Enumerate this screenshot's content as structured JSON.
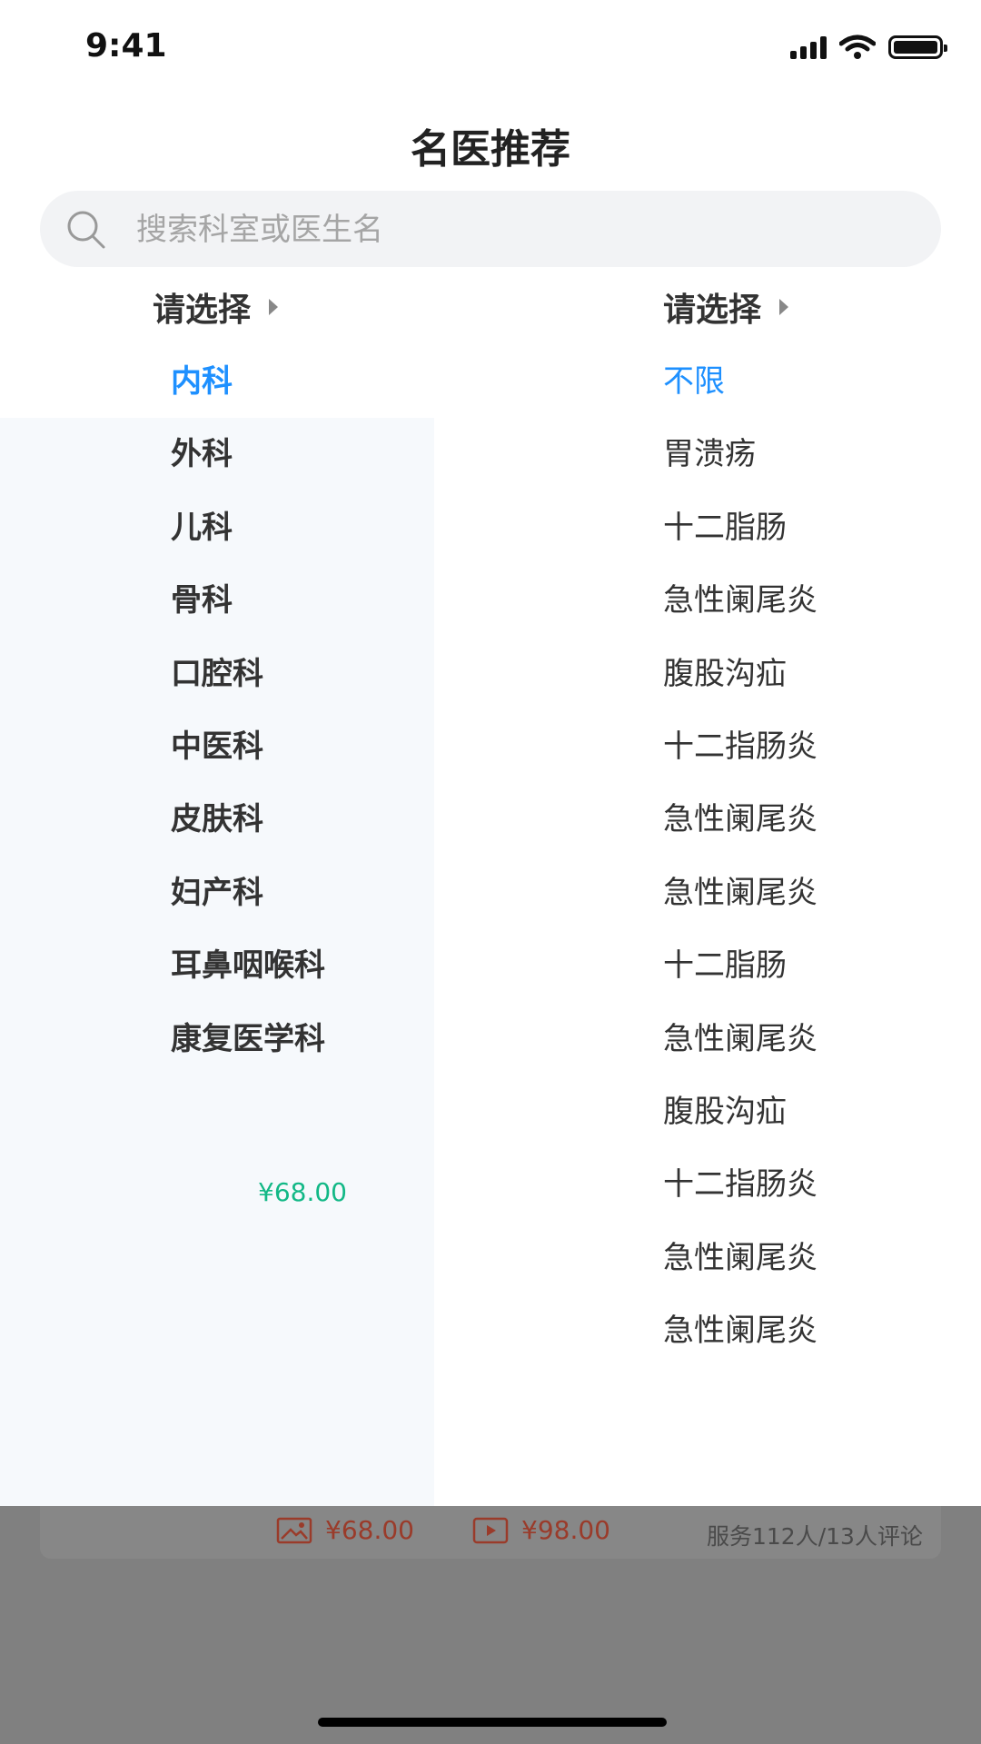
{
  "status_bar": {
    "time": "9:41"
  },
  "header": {
    "title": "名医推荐"
  },
  "search": {
    "placeholder": "搜索科室或医生名"
  },
  "filters": {
    "left_label": "请选择",
    "right_label": "请选择"
  },
  "departments": {
    "selected": "内科",
    "items": [
      "内科",
      "外科",
      "儿科",
      "骨科",
      "口腔科",
      "中医科",
      "皮肤科",
      "妇产科",
      "耳鼻咽喉科",
      "康复医学科"
    ]
  },
  "diseases": {
    "selected": "不限",
    "items": [
      "不限",
      "胃溃疡",
      "十二脂肠",
      "急性阑尾炎",
      "腹股沟疝",
      "十二指肠炎",
      "急性阑尾炎",
      "急性阑尾炎",
      "十二脂肠",
      "急性阑尾炎",
      "腹股沟疝",
      "十二指肠炎",
      "急性阑尾炎",
      "急性阑尾炎"
    ]
  },
  "left_panel_price": "¥68.00",
  "background_card": {
    "image_price": "¥68.00",
    "video_price": "¥98.00",
    "service_text": "服务112人/13人评论"
  },
  "colors": {
    "accent": "#1e90ff",
    "price_green": "#12b886",
    "price_red": "#9a3b2a"
  }
}
